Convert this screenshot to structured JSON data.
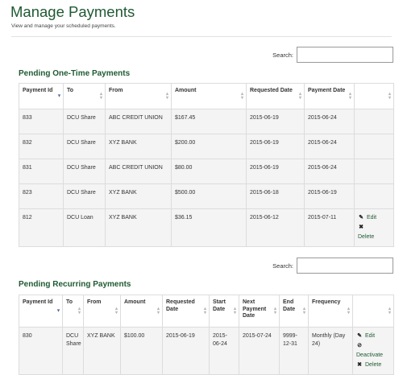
{
  "page": {
    "title": "Manage Payments",
    "subtitle": "View and manage your scheduled payments."
  },
  "search_label": "Search:",
  "one_time": {
    "title": "Pending One-Time Payments",
    "headers": [
      "Payment Id",
      "To",
      "From",
      "Amount",
      "Requested Date",
      "Payment Date",
      ""
    ],
    "rows": [
      [
        "833",
        "DCU Share",
        "ABC CREDIT UNION",
        "$167.45",
        "2015-06-19",
        "2015-06-24"
      ],
      [
        "832",
        "DCU Share",
        "XYZ BANK",
        "$200.00",
        "2015-06-19",
        "2015-06-24"
      ],
      [
        "831",
        "DCU Share",
        "ABC CREDIT UNION",
        "$80.00",
        "2015-06-19",
        "2015-06-24"
      ],
      [
        "823",
        "DCU Share",
        "XYZ BANK",
        "$500.00",
        "2015-06-18",
        "2015-06-19"
      ],
      [
        "812",
        "DCU Loan",
        "XYZ BANK",
        "$36.15",
        "2015-06-12",
        "2015-07-11"
      ]
    ],
    "actions": {
      "edit": "Edit",
      "delete": "Delete"
    }
  },
  "recurring": {
    "title": "Pending Recurring Payments",
    "headers": [
      "Payment Id",
      "To",
      "From",
      "Amount",
      "Requested Date",
      "Start Date",
      "Next Payment Date",
      "End Date",
      "Frequency",
      ""
    ],
    "rows": [
      [
        "830",
        "DCU Share",
        "XYZ BANK",
        "$100.00",
        "2015-06-19",
        "2015-06-24",
        "2015-07-24",
        "9999-12-31",
        "Monthly (Day 24)"
      ]
    ],
    "actions": {
      "edit": "Edit",
      "deactivate": "Deactivate",
      "delete": "Delete"
    }
  },
  "icons": {
    "edit": "pencil-icon",
    "delete": "x-icon",
    "deactivate": "ban-icon",
    "sort": "sort-arrows-icon"
  },
  "colors": {
    "heading": "#1f5a32",
    "row_bg": "#f4f4f4"
  }
}
